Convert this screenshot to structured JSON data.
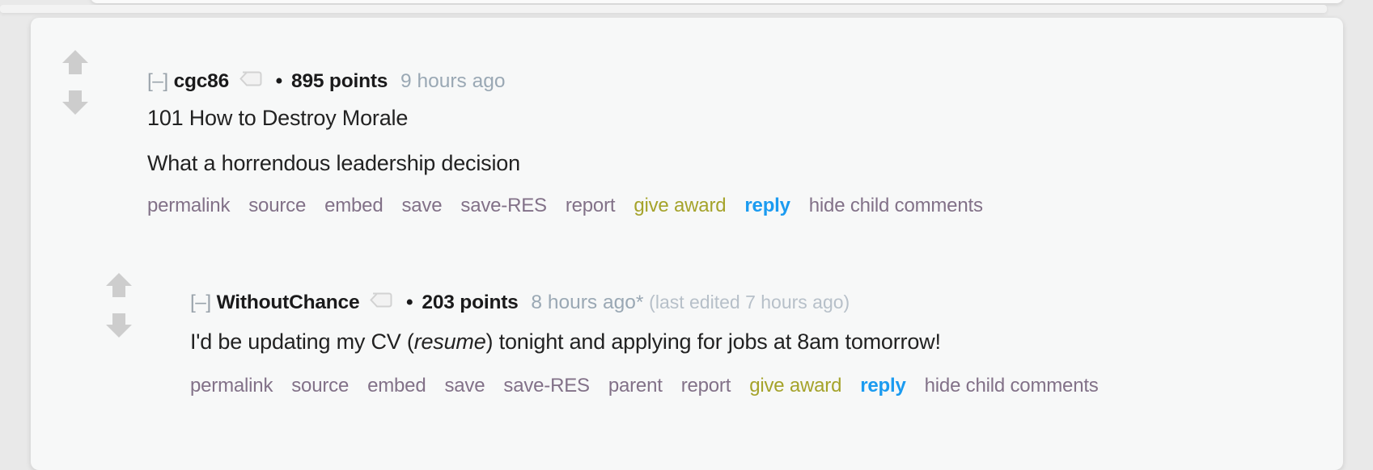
{
  "page": {
    "background_color": "#e9e9e9",
    "card_color": "#f7f8f8"
  },
  "colors": {
    "link": "#827188",
    "award_link": "#a5a32b",
    "reply_link": "#1b9bf0",
    "author": "#1a1a1b",
    "timestamp": "#9aa8b4",
    "edited_note": "#b7c0c9",
    "vote_arrow": "#cdcdcd",
    "body_text": "#222222"
  },
  "comments": [
    {
      "collapse_toggle": "[–]",
      "author": "cgc86",
      "usertag_icon": "tag-icon",
      "separator": "•",
      "score": "895 points",
      "timestamp": "9 hours ago",
      "edited_note": "",
      "upvote_icon": "upvote-arrow-icon",
      "downvote_icon": "downvote-arrow-icon",
      "paragraphs": [
        {
          "before": "101 How to Destroy Morale",
          "italic": "",
          "after": ""
        },
        {
          "before": "What a horrendous leadership decision",
          "italic": "",
          "after": ""
        }
      ],
      "actions": [
        {
          "label": "permalink",
          "style": "normal"
        },
        {
          "label": "source",
          "style": "normal"
        },
        {
          "label": "embed",
          "style": "normal"
        },
        {
          "label": "save",
          "style": "normal"
        },
        {
          "label": "save-RES",
          "style": "normal"
        },
        {
          "label": "report",
          "style": "normal"
        },
        {
          "label": "give award",
          "style": "award"
        },
        {
          "label": "reply",
          "style": "reply"
        },
        {
          "label": "hide child comments",
          "style": "normal"
        }
      ]
    },
    {
      "collapse_toggle": "[–]",
      "author": "WithoutChance",
      "usertag_icon": "tag-icon",
      "separator": "•",
      "score": "203 points",
      "timestamp": "8 hours ago*",
      "edited_note": "(last edited 7 hours ago)",
      "upvote_icon": "upvote-arrow-icon",
      "downvote_icon": "downvote-arrow-icon",
      "paragraphs": [
        {
          "before": "I'd be updating my CV (",
          "italic": "resume",
          "after": ") tonight and applying for jobs at 8am tomorrow!"
        }
      ],
      "actions": [
        {
          "label": "permalink",
          "style": "normal"
        },
        {
          "label": "source",
          "style": "normal"
        },
        {
          "label": "embed",
          "style": "normal"
        },
        {
          "label": "save",
          "style": "normal"
        },
        {
          "label": "save-RES",
          "style": "normal"
        },
        {
          "label": "parent",
          "style": "normal"
        },
        {
          "label": "report",
          "style": "normal"
        },
        {
          "label": "give award",
          "style": "award"
        },
        {
          "label": "reply",
          "style": "reply"
        },
        {
          "label": "hide child comments",
          "style": "normal"
        }
      ]
    }
  ]
}
